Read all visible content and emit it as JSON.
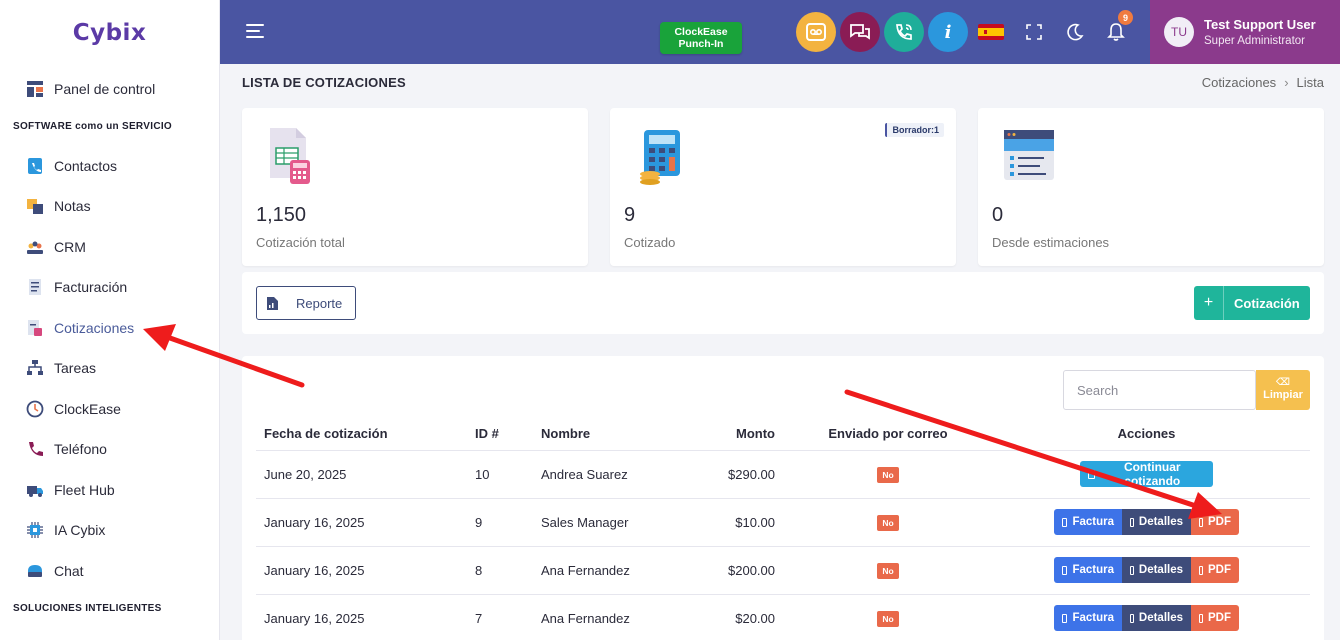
{
  "app": {
    "logo": "Cybix"
  },
  "sidebar": {
    "section1": "SOFTWARE como un SERVICIO",
    "section2": "SOLUCIONES INTELIGENTES",
    "items": [
      {
        "label": "Panel de control",
        "icon": "dashboard-icon"
      },
      {
        "label": "Contactos",
        "icon": "contacts-icon"
      },
      {
        "label": "Notas",
        "icon": "notes-icon"
      },
      {
        "label": "CRM",
        "icon": "crm-icon"
      },
      {
        "label": "Facturación",
        "icon": "invoice-icon"
      },
      {
        "label": "Cotizaciones",
        "icon": "quotes-icon"
      },
      {
        "label": "Tareas",
        "icon": "tasks-icon"
      },
      {
        "label": "ClockEase",
        "icon": "clock-icon"
      },
      {
        "label": "Teléfono",
        "icon": "phone-icon"
      },
      {
        "label": "Fleet Hub",
        "icon": "truck-icon"
      },
      {
        "label": "IA Cybix",
        "icon": "chip-icon"
      },
      {
        "label": "Chat",
        "icon": "chat-icon"
      }
    ]
  },
  "topbar": {
    "punch_line1": "ClockEase",
    "punch_line2": "Punch-In",
    "notif_count": "9",
    "user_initials": "TU",
    "user_name": "Test Support User",
    "user_role": "Super Administrator",
    "colors": {
      "bar": "#4a55a2",
      "user": "#8b3a8c",
      "voicemail": "#f3b340",
      "messages": "#8a1c55",
      "calls": "#1fae9a",
      "info": "#2b97dd"
    }
  },
  "page": {
    "title": "LISTA DE COTIZACIONES",
    "breadcrumb": [
      "Cotizaciones",
      "Lista"
    ]
  },
  "stats": [
    {
      "value": "1,150",
      "label": "Cotización total"
    },
    {
      "value": "9",
      "label": "Cotizado",
      "badge": "Borrador:1"
    },
    {
      "value": "0",
      "label": "Desde estimaciones"
    }
  ],
  "actions": {
    "report": "Reporte",
    "new_quote": "Cotización",
    "plus": "+"
  },
  "table": {
    "search_placeholder": "Search",
    "clear_label": "Limpiar",
    "headers": [
      "Fecha de cotización",
      "ID #",
      "Nombre",
      "Monto",
      "Enviado por correo",
      "Acciones"
    ],
    "rows": [
      {
        "date": "June 20, 2025",
        "id": "10",
        "name": "Andrea Suarez",
        "amount": "$290.00",
        "emailed": "No",
        "actions": [
          "Continuar cotizando"
        ]
      },
      {
        "date": "January 16, 2025",
        "id": "9",
        "name": "Sales Manager",
        "amount": "$10.00",
        "emailed": "No",
        "actions": [
          "Factura",
          "Detalles",
          "PDF"
        ]
      },
      {
        "date": "January 16, 2025",
        "id": "8",
        "name": "Ana Fernandez",
        "amount": "$200.00",
        "emailed": "No",
        "actions": [
          "Factura",
          "Detalles",
          "PDF"
        ]
      },
      {
        "date": "January 16, 2025",
        "id": "7",
        "name": "Ana Fernandez",
        "amount": "$20.00",
        "emailed": "No",
        "actions": [
          "Factura",
          "Detalles",
          "PDF"
        ]
      }
    ]
  },
  "annotations": {
    "arrow_color": "#ee1c1c"
  }
}
